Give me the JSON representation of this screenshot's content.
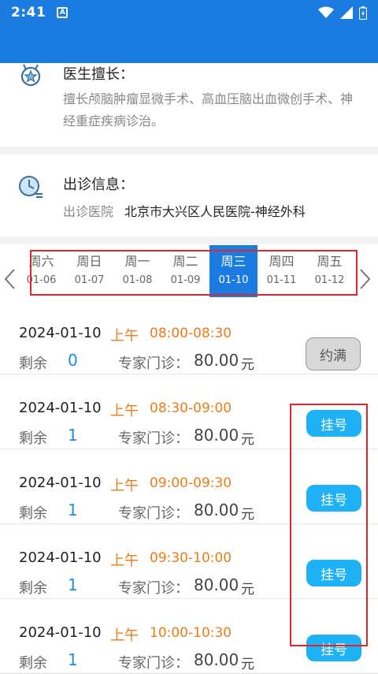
{
  "status_bar": {
    "time": "2:41",
    "notif_icon_letter": "A"
  },
  "skill": {
    "title": "医生擅长：",
    "text": "擅长颅脑肿瘤显微手术、高血压脑出血微创手术、神经重症疾病诊治。"
  },
  "visit": {
    "title": "出诊信息：",
    "hospital_label": "出诊医院",
    "hospital_value": "北京市大兴区人民医院-神经外科"
  },
  "week": {
    "days": [
      {
        "name": "周六",
        "date": "01-06",
        "selected": false
      },
      {
        "name": "周日",
        "date": "01-07",
        "selected": false
      },
      {
        "name": "周一",
        "date": "01-08",
        "selected": false
      },
      {
        "name": "周二",
        "date": "01-09",
        "selected": false
      },
      {
        "name": "周三",
        "date": "01-10",
        "selected": true
      },
      {
        "name": "周四",
        "date": "01-11",
        "selected": false
      },
      {
        "name": "周五",
        "date": "01-12",
        "selected": false
      }
    ]
  },
  "slots": [
    {
      "date": "2024-01-10",
      "period": "上午",
      "time": "08:00-08:30",
      "remain_label": "剩余",
      "remain": "0",
      "fee_label": "专家门诊：",
      "fee": "80.00",
      "unit": "元",
      "button": "约满",
      "full": true
    },
    {
      "date": "2024-01-10",
      "period": "上午",
      "time": "08:30-09:00",
      "remain_label": "剩余",
      "remain": "1",
      "fee_label": "专家门诊：",
      "fee": "80.00",
      "unit": "元",
      "button": "挂号",
      "full": false
    },
    {
      "date": "2024-01-10",
      "period": "上午",
      "time": "09:00-09:30",
      "remain_label": "剩余",
      "remain": "1",
      "fee_label": "专家门诊：",
      "fee": "80.00",
      "unit": "元",
      "button": "挂号",
      "full": false
    },
    {
      "date": "2024-01-10",
      "period": "上午",
      "time": "09:30-10:00",
      "remain_label": "剩余",
      "remain": "1",
      "fee_label": "专家门诊：",
      "fee": "80.00",
      "unit": "元",
      "button": "挂号",
      "full": false
    },
    {
      "date": "2024-01-10",
      "period": "上午",
      "time": "10:00-10:30",
      "remain_label": "剩余",
      "remain": "1",
      "fee_label": "专家门诊：",
      "fee": "80.00",
      "unit": "元",
      "button": "挂号",
      "full": false
    }
  ],
  "colors": {
    "primary": "#1a7ce0",
    "orange": "#f07b15",
    "button": "#1fb1f5",
    "highlight": "#e0262d"
  }
}
